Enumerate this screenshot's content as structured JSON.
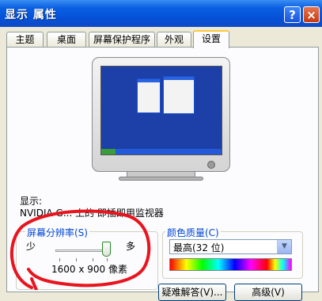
{
  "window": {
    "title": "显示 属性",
    "help_button": "?",
    "close_button": "×"
  },
  "tabs": [
    {
      "label": "主题"
    },
    {
      "label": "桌面"
    },
    {
      "label": "屏幕保护程序"
    },
    {
      "label": "外观"
    },
    {
      "label": "设置",
      "active": true
    }
  ],
  "display": {
    "label": "显示:",
    "value": "NVIDIA G... 上的 即插即用监视器"
  },
  "resolution": {
    "group_title": "屏幕分辨率(S)",
    "min_label": "少",
    "max_label": "多",
    "value": "1600 x 900 像素",
    "slider_level": 1.0
  },
  "color_quality": {
    "group_title": "颜色质量(C)",
    "selected": "最高(32 位)"
  },
  "buttons": {
    "troubleshoot": "疑难解答(V)...",
    "advanced": "高级(V)"
  },
  "colors": {
    "title_bar": "#0550d6",
    "annotation": "#e8141e",
    "group_title": "#0046d5"
  }
}
